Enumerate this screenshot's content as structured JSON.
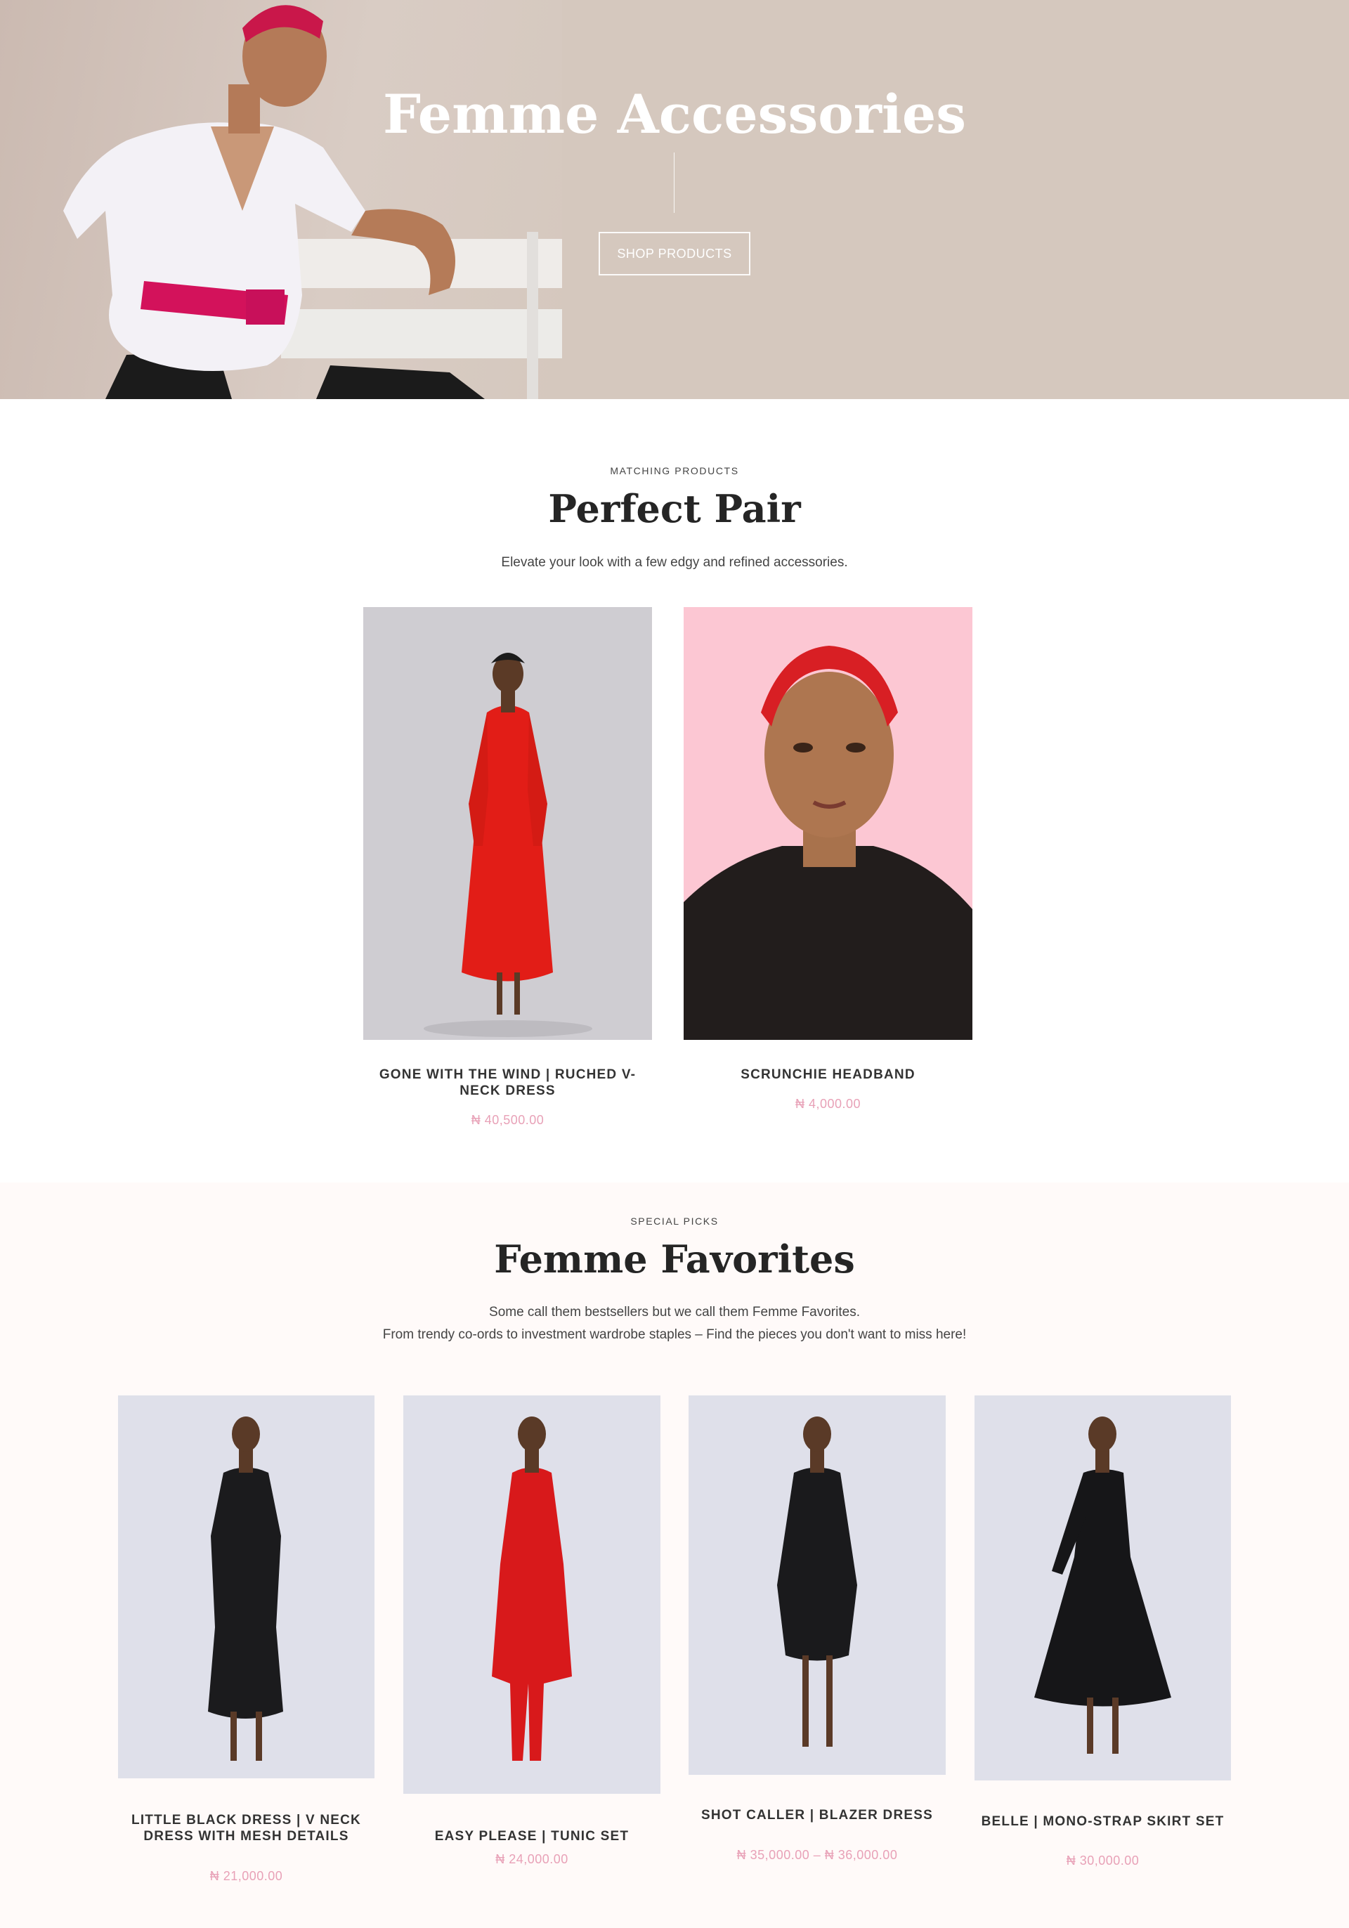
{
  "hero": {
    "title": "Femme Accessories",
    "button_label": "SHOP PRODUCTS",
    "bg_color": "#d5c8be"
  },
  "pair": {
    "eyebrow": "MATCHING PRODUCTS",
    "title": "Perfect Pair",
    "description": "Elevate your look with a few edgy and refined accessories.",
    "products": [
      {
        "name": "GONE WITH THE WIND | RUCHED V-NECK DRESS",
        "price": "₦ 40,500.00"
      },
      {
        "name": "SCRUNCHIE HEADBAND",
        "price": "₦ 4,000.00"
      }
    ]
  },
  "favorites": {
    "eyebrow": "SPECIAL PICKS",
    "title": "Femme Favorites",
    "description_line1": "Some call them bestsellers but we call them Femme Favorites.",
    "description_line2": "From trendy co-ords to investment wardrobe staples – Find the pieces you don't want to miss here!",
    "products": [
      {
        "name": "LITTLE BLACK DRESS | V NECK DRESS WITH MESH DETAILS",
        "price": "₦ 21,000.00"
      },
      {
        "name": "EASY PLEASE | TUNIC SET",
        "price": "₦ 24,000.00"
      },
      {
        "name": "SHOT CALLER | BLAZER DRESS",
        "price": "₦ 35,000.00 – ₦ 36,000.00"
      },
      {
        "name": "BELLE | MONO-STRAP SKIRT SET",
        "price": "₦ 30,000.00"
      }
    ]
  },
  "colors": {
    "accent_pink": "#e8a1b7",
    "hero_bg": "#d5c8be",
    "favorites_bg": "#fffaf9"
  }
}
